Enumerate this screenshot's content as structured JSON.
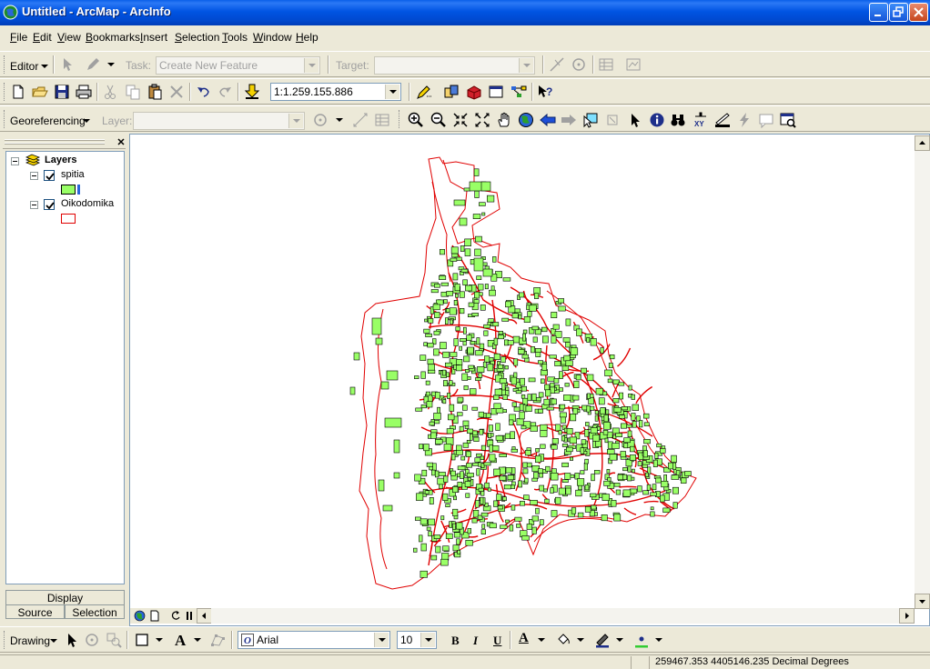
{
  "window": {
    "title": "Untitled - ArcMap - ArcInfo"
  },
  "menu": [
    "File",
    "Edit",
    "View",
    "Bookmarks",
    "Insert",
    "Selection",
    "Tools",
    "Window",
    "Help"
  ],
  "editor_toolbar": {
    "editor_label": "Editor",
    "task_label": "Task:",
    "task_value": "Create New Feature",
    "target_label": "Target:",
    "target_value": ""
  },
  "standard_toolbar": {
    "scale_value": "1:1.259.155.886"
  },
  "georef_toolbar": {
    "georef_label": "Georeferencing",
    "layer_label": "Layer:",
    "layer_value": ""
  },
  "toc": {
    "root_label": "Layers",
    "layers": [
      {
        "name": "spitia",
        "checked": true,
        "fill": "#99FF66",
        "stroke": "#000000"
      },
      {
        "name": "Oikodomika",
        "checked": true,
        "fill": "#FFFFFF",
        "stroke": "#E00000"
      }
    ],
    "tabs": {
      "display": "Display",
      "source": "Source",
      "selection": "Selection"
    }
  },
  "drawing_toolbar": {
    "drawing_label": "Drawing",
    "font_name": "Arial",
    "font_size": "10",
    "bold": "B",
    "italic": "I",
    "underline": "U",
    "text_tool": "A"
  },
  "status": {
    "coords": "259467.353  4405146.235 Decimal Degrees"
  },
  "colors": {
    "building_fill": "#99FF66",
    "boundary_red": "#E00000",
    "title_blue": "#0054E3"
  }
}
